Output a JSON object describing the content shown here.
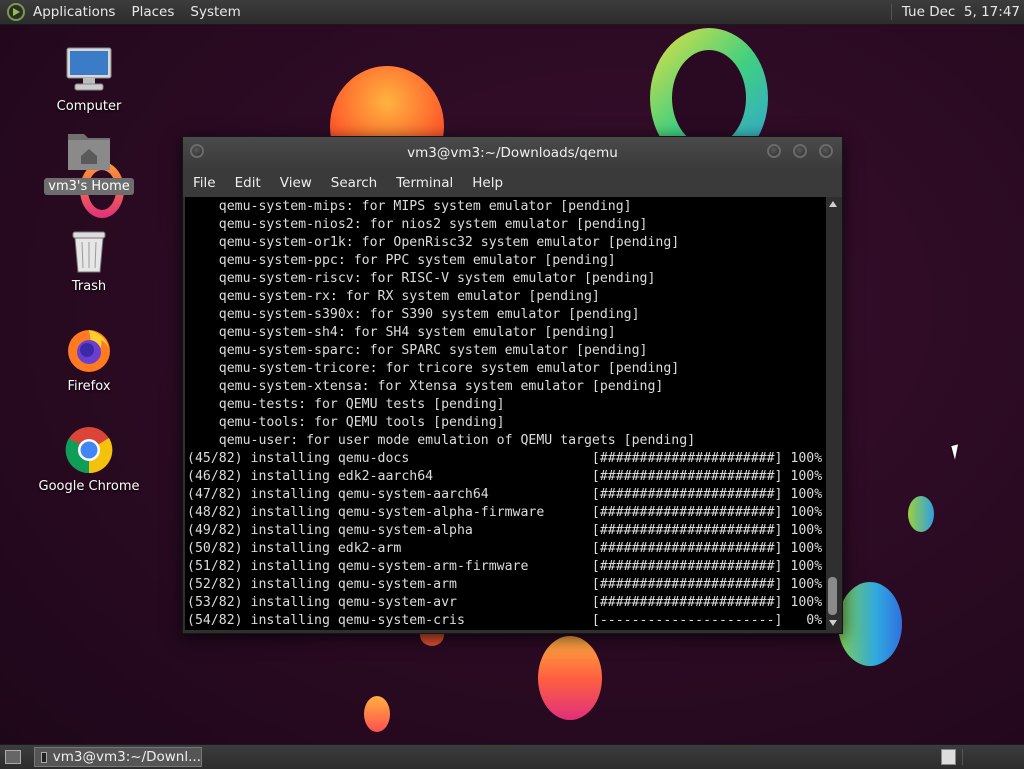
{
  "top_panel": {
    "menus": [
      "Applications",
      "Places",
      "System"
    ],
    "clock": "Tue Dec  5, 17:47"
  },
  "desktop_icons": [
    {
      "label": "Computer",
      "icon": "computer-icon"
    },
    {
      "label": "vm3's Home",
      "icon": "home-folder-icon"
    },
    {
      "label": "Trash",
      "icon": "trash-icon"
    },
    {
      "label": "Firefox",
      "icon": "firefox-icon"
    },
    {
      "label": "Google Chrome",
      "icon": "chrome-icon"
    }
  ],
  "terminal": {
    "title": "vm3@vm3:~/Downloads/qemu",
    "menu": [
      "File",
      "Edit",
      "View",
      "Search",
      "Terminal",
      "Help"
    ],
    "lines": [
      "    qemu-system-mips: for MIPS system emulator [pending]",
      "    qemu-system-nios2: for nios2 system emulator [pending]",
      "    qemu-system-or1k: for OpenRisc32 system emulator [pending]",
      "    qemu-system-ppc: for PPC system emulator [pending]",
      "    qemu-system-riscv: for RISC-V system emulator [pending]",
      "    qemu-system-rx: for RX system emulator [pending]",
      "    qemu-system-s390x: for S390 system emulator [pending]",
      "    qemu-system-sh4: for SH4 system emulator [pending]",
      "    qemu-system-sparc: for SPARC system emulator [pending]",
      "    qemu-system-tricore: for tricore system emulator [pending]",
      "    qemu-system-xtensa: for Xtensa system emulator [pending]",
      "    qemu-tests: for QEMU tests [pending]",
      "    qemu-tools: for QEMU tools [pending]",
      "    qemu-user: for user mode emulation of QEMU targets [pending]",
      "(45/82) installing qemu-docs                       [######################] 100%",
      "(46/82) installing edk2-aarch64                    [######################] 100%",
      "(47/82) installing qemu-system-aarch64             [######################] 100%",
      "(48/82) installing qemu-system-alpha-firmware      [######################] 100%",
      "(49/82) installing qemu-system-alpha               [######################] 100%",
      "(50/82) installing edk2-arm                        [######################] 100%",
      "(51/82) installing qemu-system-arm-firmware        [######################] 100%",
      "(52/82) installing qemu-system-arm                 [######################] 100%",
      "(53/82) installing qemu-system-avr                 [######################] 100%",
      "(54/82) installing qemu-system-cris                [----------------------]   0%"
    ]
  },
  "taskbar": {
    "window_button": "vm3@vm3:~/Downl..."
  },
  "colors": {
    "desktop_bg": "#2a0a22",
    "panel_bg": "#353535",
    "terminal_bg": "#000000",
    "terminal_fg": "#dcdcdc"
  }
}
